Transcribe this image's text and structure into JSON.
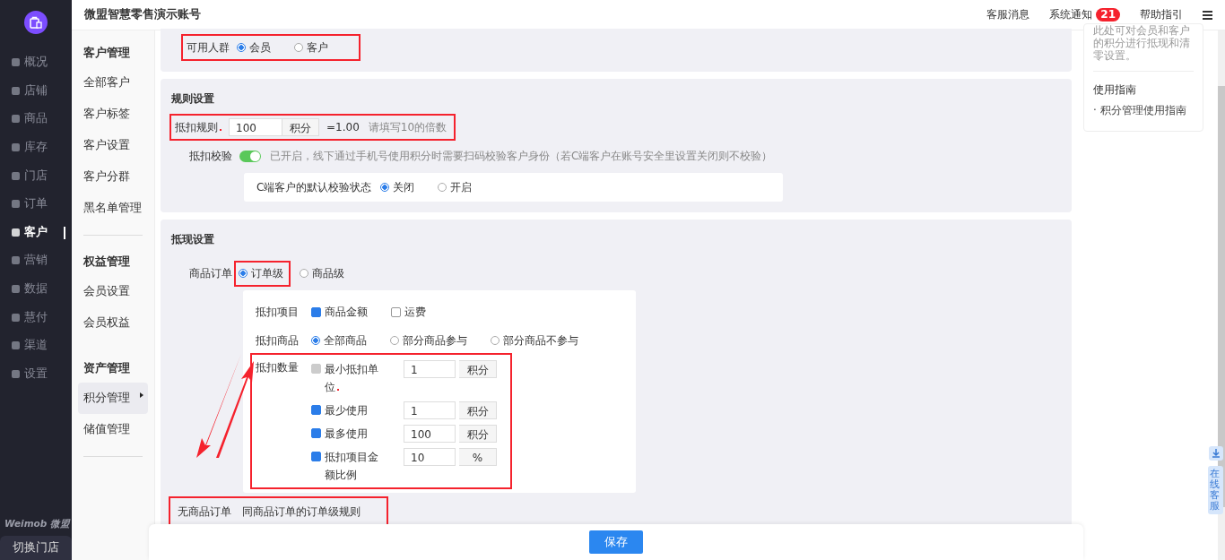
{
  "nav": {
    "items": [
      {
        "label": "概况",
        "selected": false
      },
      {
        "label": "店铺",
        "selected": false
      },
      {
        "label": "商品",
        "selected": false
      },
      {
        "label": "库存",
        "selected": false
      },
      {
        "label": "门店",
        "selected": false
      },
      {
        "label": "订单",
        "selected": false
      },
      {
        "label": "客户",
        "selected": true
      },
      {
        "label": "营销",
        "selected": false
      },
      {
        "label": "数据",
        "selected": false
      },
      {
        "label": "慧付",
        "selected": false
      },
      {
        "label": "渠道",
        "selected": false
      },
      {
        "label": "设置",
        "selected": false
      }
    ],
    "brand": "Weimob 微盟",
    "switch_store": "切换门店"
  },
  "header": {
    "title": "微盟智慧零售演示账号",
    "links": [
      "客服消息",
      "系统通知",
      "帮助指引"
    ],
    "badge": "21"
  },
  "subnav": {
    "groups": [
      {
        "title": "客户管理",
        "items": [
          {
            "label": "全部客户",
            "selected": false
          },
          {
            "label": "客户标签",
            "selected": false
          },
          {
            "label": "客户设置",
            "selected": false
          },
          {
            "label": "客户分群",
            "selected": false
          },
          {
            "label": "黑名单管理",
            "selected": false
          }
        ]
      },
      {
        "title": "权益管理",
        "items": [
          {
            "label": "会员设置",
            "selected": false
          },
          {
            "label": "会员权益",
            "selected": false
          }
        ]
      },
      {
        "title": "资产管理",
        "items": [
          {
            "label": "积分管理",
            "selected": true
          },
          {
            "label": "储值管理",
            "selected": false
          }
        ]
      }
    ]
  },
  "audience": {
    "label": "可用人群",
    "highlighted": true,
    "options": [
      {
        "label": "会员",
        "selected": true
      },
      {
        "label": "客户",
        "selected": false
      }
    ]
  },
  "rules": {
    "title": "规则设置",
    "rule": {
      "label": "抵扣规则",
      "highlighted": true,
      "value": "100",
      "unit": "积分",
      "equals": "=1.00",
      "hint": "请填写10的倍数"
    },
    "verify": {
      "label": "抵扣校验",
      "on": true,
      "note": "已开启，线下通过手机号使用积分时需要扫码校验客户身份（若C端客户在账号安全里设置关闭则不校验）"
    },
    "default_state": {
      "label": "C端客户的默认校验状态",
      "options": [
        {
          "label": "关闭",
          "selected": true
        },
        {
          "label": "开启",
          "selected": false
        }
      ]
    }
  },
  "cash": {
    "title": "抵现设置",
    "order_label": "商品订单",
    "order_options": [
      {
        "label": "订单级",
        "selected": true,
        "highlighted": true
      },
      {
        "label": "商品级",
        "selected": false,
        "highlighted": false
      }
    ],
    "items_label": "抵扣项目",
    "items": [
      {
        "label": "商品金额",
        "checked": true
      },
      {
        "label": "运费",
        "checked": false
      }
    ],
    "goods_label": "抵扣商品",
    "goods": [
      {
        "label": "全部商品",
        "selected": true
      },
      {
        "label": "部分商品参与",
        "selected": false
      },
      {
        "label": "部分商品不参与",
        "selected": false
      }
    ],
    "qty_label": "抵扣数量",
    "qty_highlighted": true,
    "qty": [
      {
        "label": "最小抵扣单位",
        "required": true,
        "checked": true,
        "disabled": true,
        "value": "1",
        "unit": "积分"
      },
      {
        "label": "最少使用",
        "required": false,
        "checked": true,
        "disabled": false,
        "value": "1",
        "unit": "积分"
      },
      {
        "label": "最多使用",
        "required": false,
        "checked": true,
        "disabled": false,
        "value": "100",
        "unit": "积分"
      },
      {
        "label": "抵扣项目金额比例",
        "required": false,
        "checked": true,
        "disabled": false,
        "value": "10",
        "unit": "%"
      }
    ],
    "no_goods": {
      "label": "无商品订单",
      "value": "同商品订单的订单级规则",
      "highlighted": true
    }
  },
  "help": {
    "intro": "此处可对会员和客户的积分进行抵现和清零设置。",
    "guide_title": "使用指南",
    "guide_link": "· 积分管理使用指南"
  },
  "save": "保存",
  "side_tab": "在线客服"
}
